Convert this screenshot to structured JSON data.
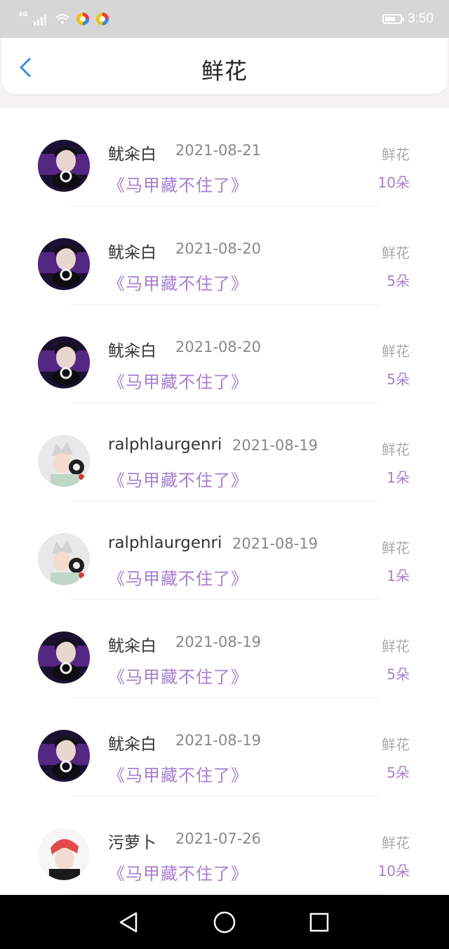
{
  "status_bar": {
    "network": "4G",
    "time": "3:50"
  },
  "header": {
    "title": "鲜花"
  },
  "flower_label": "鲜花",
  "items": [
    {
      "name": "鱿籴白",
      "date": "2021-08-21",
      "book": "《马甲藏不住了》",
      "count": "10朵",
      "avatar": "purple"
    },
    {
      "name": "鱿籴白",
      "date": "2021-08-20",
      "book": "《马甲藏不住了》",
      "count": "5朵",
      "avatar": "purple"
    },
    {
      "name": "鱿籴白",
      "date": "2021-08-20",
      "book": "《马甲藏不住了》",
      "count": "5朵",
      "avatar": "purple"
    },
    {
      "name": "ralphlaurgenri",
      "date": "2021-08-19",
      "book": "《马甲藏不住了》",
      "count": "1朵",
      "avatar": "light"
    },
    {
      "name": "ralphlaurgenri",
      "date": "2021-08-19",
      "book": "《马甲藏不住了》",
      "count": "1朵",
      "avatar": "light"
    },
    {
      "name": "鱿籴白",
      "date": "2021-08-19",
      "book": "《马甲藏不住了》",
      "count": "5朵",
      "avatar": "purple"
    },
    {
      "name": "鱿籴白",
      "date": "2021-08-19",
      "book": "《马甲藏不住了》",
      "count": "5朵",
      "avatar": "purple"
    },
    {
      "name": "污萝卜",
      "date": "2021-07-26",
      "book": "《马甲藏不住了》",
      "count": "10朵",
      "avatar": "red"
    }
  ],
  "colors": {
    "accent": "#a77fd3",
    "back_arrow": "#2f8cf0"
  }
}
